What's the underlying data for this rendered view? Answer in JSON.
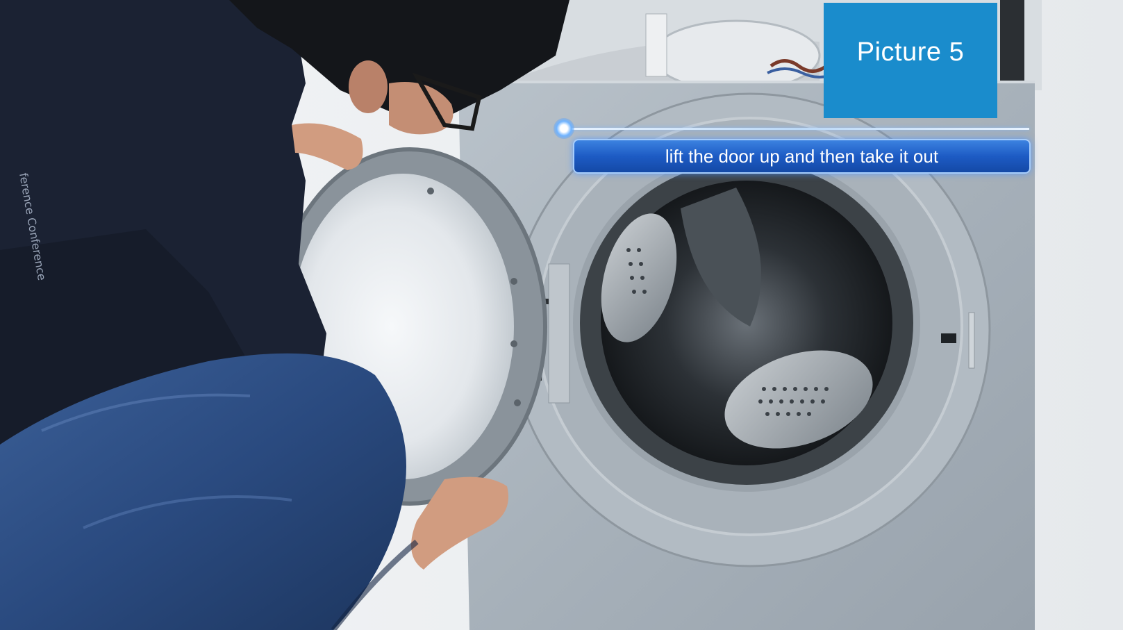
{
  "badge": {
    "label": "Picture 5",
    "color": "#1a8ccc"
  },
  "caption": {
    "text": "lift the door up and then take it out",
    "color": "#1d5bc4"
  },
  "shirt_text": {
    "label": "ference Conference"
  }
}
